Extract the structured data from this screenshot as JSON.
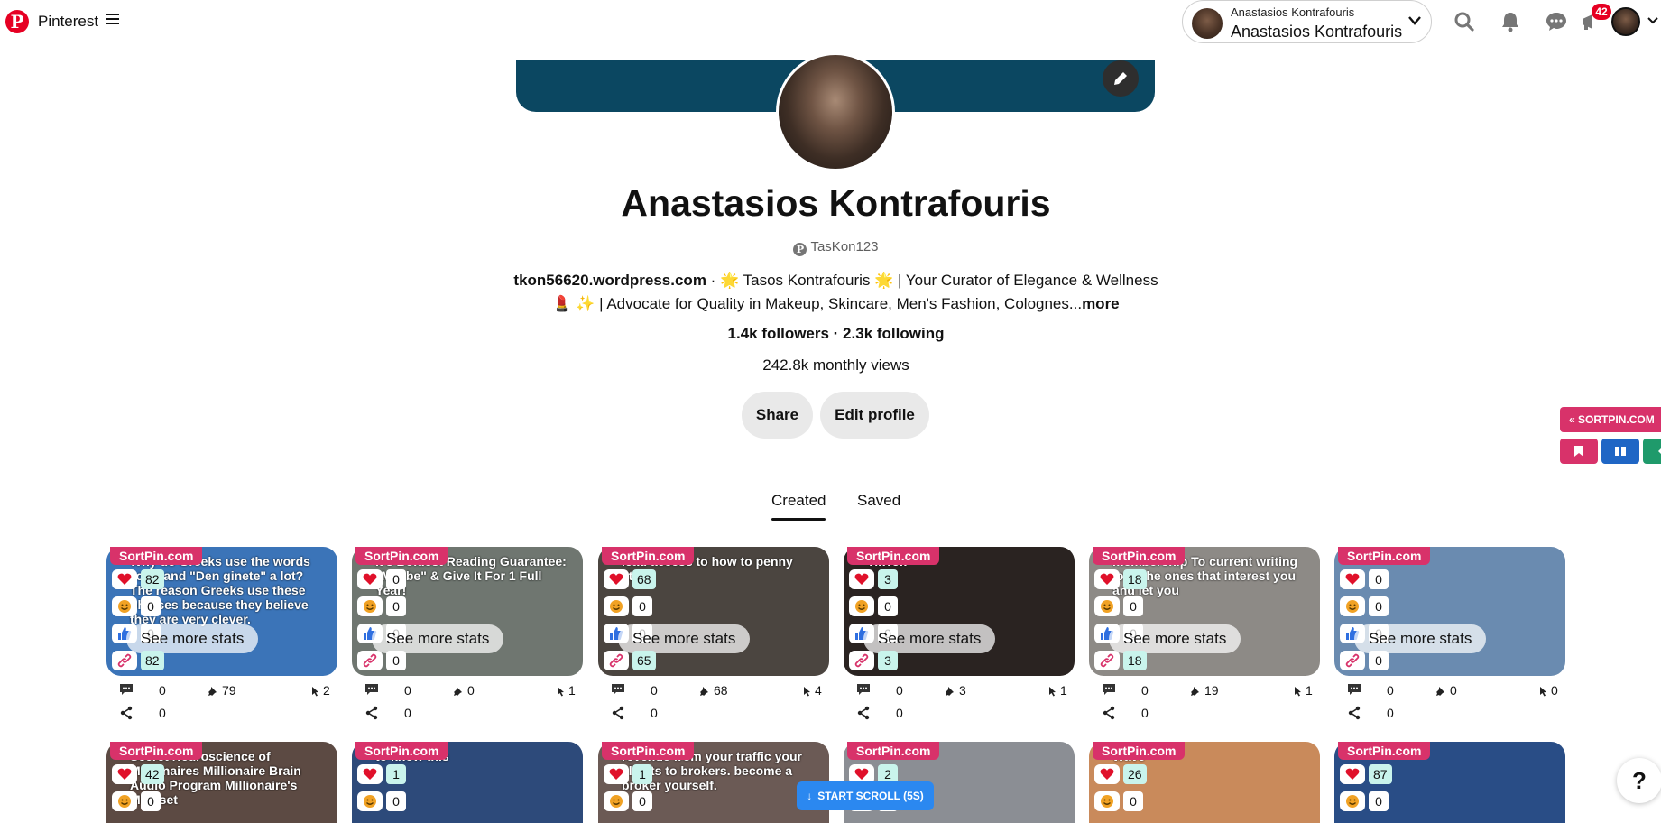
{
  "topbar": {
    "brand": "Pinterest",
    "account_small": "Anastasios Kontrafouris",
    "account_name": "Anastasios Kontrafouris",
    "notification_count": "42"
  },
  "profile": {
    "name": "Anastasios Kontrafouris",
    "username": "TasKon123",
    "website": "tkon56620.wordpress.com",
    "bio_line1": " · 🌟 Tasos Kontrafouris 🌟 | Your Curator of Elegance & Wellness",
    "bio_line2": "💄 ✨ | Advocate for Quality in Makeup, Skincare, Men's Fashion, Colognes...",
    "more": "more",
    "followers": "1.4k followers · 2.3k following",
    "monthly_views": "242.8k monthly views",
    "share_label": "Share",
    "edit_label": "Edit profile"
  },
  "sortpin_widget": {
    "header": "SORTPIN.COM"
  },
  "tabs": [
    {
      "label": "Created",
      "active": true
    },
    {
      "label": "Saved",
      "active": false
    }
  ],
  "pins": [
    {
      "label": "SortPin.com",
      "likes": "82",
      "smiles": "0",
      "thumbs": "0",
      "links": "82",
      "comments": "0",
      "saves": "79",
      "clicks": "2",
      "shares": "0",
      "see_more": "See more stats",
      "image_text": "Why do Greeks use the words \"oxi\" and \"Den ginete\" a lot? The reason Greeks use these phrases because they believe they are very clever.",
      "bg": "#3b74b8"
    },
    {
      "label": "SortPin.com",
      "likes": "0",
      "smiles": "0",
      "thumbs": "0",
      "links": "0",
      "comments": "0",
      "saves": "0",
      "clicks": "1",
      "shares": "0",
      "see_more": "See more stats",
      "image_text": "It's Boldest Reading Guarantee: \"Maybe\" & Give It For 1 Full Year!",
      "bg": "#6f7670"
    },
    {
      "label": "SortPin.com",
      "likes": "68",
      "smiles": "0",
      "thumbs": "0",
      "links": "65",
      "comments": "0",
      "saves": "68",
      "clicks": "4",
      "shares": "0",
      "see_more": "See more stats",
      "image_text": "lead access to how to penny stock",
      "bg": "#4b4540"
    },
    {
      "label": "SortPin.com",
      "likes": "3",
      "smiles": "0",
      "thumbs": "0",
      "links": "3",
      "comments": "0",
      "saves": "3",
      "clicks": "1",
      "shares": "0",
      "see_more": "See more stats",
      "image_text": "TikTok",
      "bg": "#2a2321"
    },
    {
      "label": "SortPin.com",
      "likes": "18",
      "smiles": "0",
      "thumbs": "0",
      "links": "18",
      "comments": "0",
      "saves": "19",
      "clicks": "1",
      "shares": "0",
      "see_more": "See more stats",
      "image_text": "membership To current writing jobs the ones that interest you and let you",
      "bg": "#8d8a86"
    },
    {
      "label": "SortPin.com",
      "likes": "0",
      "smiles": "0",
      "thumbs": "0",
      "links": "0",
      "comments": "0",
      "saves": "0",
      "clicks": "0",
      "shares": "0",
      "see_more": "See more stats",
      "image_text": "",
      "bg": "#6a8bb0"
    }
  ],
  "pins_row2": [
    {
      "label": "SortPin.com",
      "likes": "42",
      "smiles": "0",
      "image_text": "Secret Neuroscience of Millionaires Millionaire Brain Audio Program Millionaire's Mindset",
      "bg": "#5c4a43"
    },
    {
      "label": "SortPin.com",
      "likes": "1",
      "smiles": "0",
      "image_text": "to know this",
      "bg": "#2d4a7a"
    },
    {
      "label": "SortPin.com",
      "likes": "1",
      "smiles": "0",
      "image_text": "revenue from your traffic your clients to brokers. become a broker yourself.",
      "bg": "#6b5a55"
    },
    {
      "label": "SortPin.com",
      "likes": "2",
      "smiles": "0",
      "image_text": "",
      "bg": "#8b8e94"
    },
    {
      "label": "SortPin.com",
      "likes": "26",
      "smiles": "0",
      "image_text": "Wave",
      "bg": "#c98a5b"
    },
    {
      "label": "SortPin.com",
      "likes": "87",
      "smiles": "0",
      "image_text": "",
      "bg": "#294d86"
    }
  ],
  "scroll_button": "START SCROLL (5S)",
  "help": "?",
  "colors": {
    "pinterest_red": "#e60023",
    "sortpin_pink": "#d8326a",
    "cover_blue": "#0b4761",
    "scroll_blue": "#2b88f0"
  }
}
